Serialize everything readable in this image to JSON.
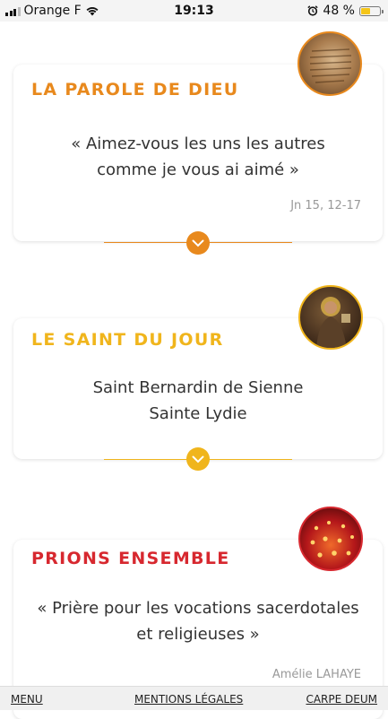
{
  "status_bar": {
    "carrier": "Orange F",
    "time": "19:13",
    "battery_percent": "48 %",
    "battery_level": 0.48
  },
  "cards": [
    {
      "title": "LA PAROLE DE DIEU",
      "title_color": "#e8891d",
      "accent_color": "#e8891d",
      "lines": [
        "« Aimez-vous les uns les autres",
        "comme je vous ai aimé »"
      ],
      "reference": "Jn 15, 12-17",
      "icon": "bible-scroll-thumbnail"
    },
    {
      "title": "LE SAINT DU JOUR",
      "title_color": "#f0b51c",
      "accent_color": "#f0b51c",
      "lines": [
        "Saint Bernardin de Sienne",
        "Sainte Lydie"
      ],
      "icon": "saint-portrait-thumbnail"
    },
    {
      "title": "PRIONS ENSEMBLE",
      "title_color": "#d7282f",
      "accent_color": "#d7282f",
      "lines": [
        "« Prière pour les vocations sacerdotales",
        "et religieuses »"
      ],
      "reference": "Amélie LAHAYE",
      "icon": "candles-thumbnail"
    }
  ],
  "bottom_bar": {
    "menu": "MENU",
    "legal": "MENTIONS LÉGALES",
    "carpe": "CARPE DEUM"
  }
}
